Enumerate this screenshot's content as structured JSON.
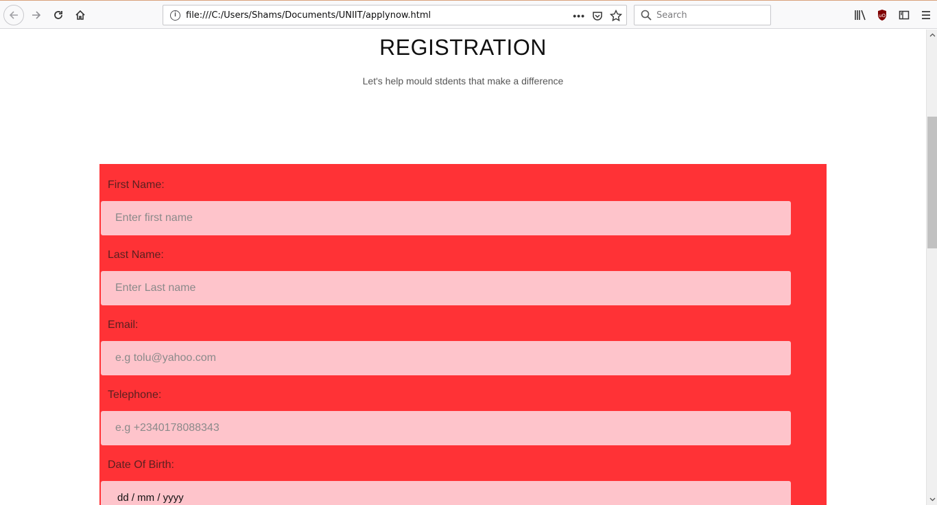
{
  "browser": {
    "url": "file:///C:/Users/Shams/Documents/UNIIT/applynow.html",
    "search_placeholder": "Search",
    "url_menu_icon": "•••"
  },
  "page": {
    "title": "REGISTRATION",
    "subtitle": "Let's help mould stdents that make a difference"
  },
  "form": {
    "first_name_label": "First Name:",
    "first_name_placeholder": "Enter first name",
    "last_name_label": "Last Name:",
    "last_name_placeholder": "Enter Last name",
    "email_label": "Email:",
    "email_placeholder": "e.g tolu@yahoo.com",
    "telephone_label": "Telephone:",
    "telephone_placeholder": "e.g +2340178088343",
    "dob_label": "Date Of Birth:",
    "dob_placeholder": "dd / mm / yyyy"
  },
  "colors": {
    "form_background": "#ff3236",
    "input_background": "#fec4cb"
  },
  "icons": {
    "back": "back-arrow-icon",
    "forward": "forward-arrow-icon",
    "reload": "reload-icon",
    "home": "home-icon",
    "info": "info-icon",
    "pocket": "pocket-icon",
    "bookmark": "star-icon",
    "library": "library-icon",
    "ublock": "ublock-icon",
    "sidebar": "sidebar-icon",
    "menu": "hamburger-menu-icon"
  }
}
